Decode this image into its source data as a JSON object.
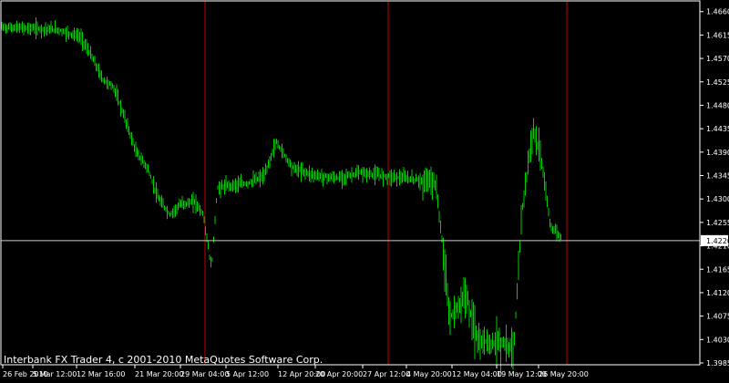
{
  "copyright": "Interbank FX Trader 4, c 2001-2010 MetaQuotes Software Corp.",
  "colors": {
    "background": "#000000",
    "frame": "#ffffff",
    "bars": "#00cc00",
    "period_separator": "#c00000",
    "bid_line": "#cccccc",
    "bid_box_bg": "#ffffff",
    "bid_box_text": "#000000",
    "text": "#ffffff"
  },
  "chart_data": {
    "type": "bar",
    "ylim": [
      1.3985,
      1.467
    ],
    "y_ticks": [
      "1.4660",
      "1.4615",
      "1.4570",
      "1.4525",
      "1.4480",
      "1.4435",
      "1.4390",
      "1.4345",
      "1.4300",
      "1.4255",
      "1.4210",
      "1.4165",
      "1.4120",
      "1.4075",
      "1.4030",
      "1.3985"
    ],
    "x_tick_labels": [
      "26 Feb 2010",
      "5 Mar 12:00",
      "12 Mar 16:00",
      "21 Mar 20:00",
      "29 Mar 04:00",
      "5 Apr 12:00",
      "12 Apr 20:00",
      "20 Apr 20:00",
      "27 Apr 12:00",
      "4 May 20:00",
      "12 May 04:00",
      "19 May 12:00",
      "26 May 20:00"
    ],
    "period_separators": [
      "29 Mar 04:00",
      "27 Apr 12:00",
      "26 May 20:00"
    ],
    "current_price": "1.4220",
    "price_path": [
      [
        0,
        1.463
      ],
      [
        0.05,
        1.4628
      ],
      [
        0.1,
        1.4625
      ],
      [
        0.14,
        1.4612
      ],
      [
        0.16,
        1.4575
      ],
      [
        0.18,
        1.453
      ],
      [
        0.2,
        1.4515
      ],
      [
        0.22,
        1.4455
      ],
      [
        0.24,
        1.439
      ],
      [
        0.26,
        1.436
      ],
      [
        0.28,
        1.43
      ],
      [
        0.3,
        1.427
      ],
      [
        0.32,
        1.429
      ],
      [
        0.345,
        1.4295
      ],
      [
        0.36,
        1.427
      ],
      [
        0.375,
        1.4165
      ],
      [
        0.385,
        1.432
      ],
      [
        0.4,
        1.4325
      ],
      [
        0.44,
        1.433
      ],
      [
        0.47,
        1.4345
      ],
      [
        0.49,
        1.441
      ],
      [
        0.52,
        1.436
      ],
      [
        0.56,
        1.4345
      ],
      [
        0.6,
        1.434
      ],
      [
        0.64,
        1.435
      ],
      [
        0.68,
        1.4345
      ],
      [
        0.72,
        1.434
      ],
      [
        0.76,
        1.4335
      ],
      [
        0.775,
        1.433
      ],
      [
        0.785,
        1.424
      ],
      [
        0.8,
        1.407
      ],
      [
        0.83,
        1.4115
      ],
      [
        0.85,
        1.403
      ],
      [
        0.89,
        1.402
      ],
      [
        0.915,
        1.4015
      ],
      [
        0.93,
        1.428
      ],
      [
        0.95,
        1.444
      ],
      [
        0.965,
        1.437
      ],
      [
        0.98,
        1.425
      ],
      [
        1.0,
        1.4225
      ]
    ]
  }
}
